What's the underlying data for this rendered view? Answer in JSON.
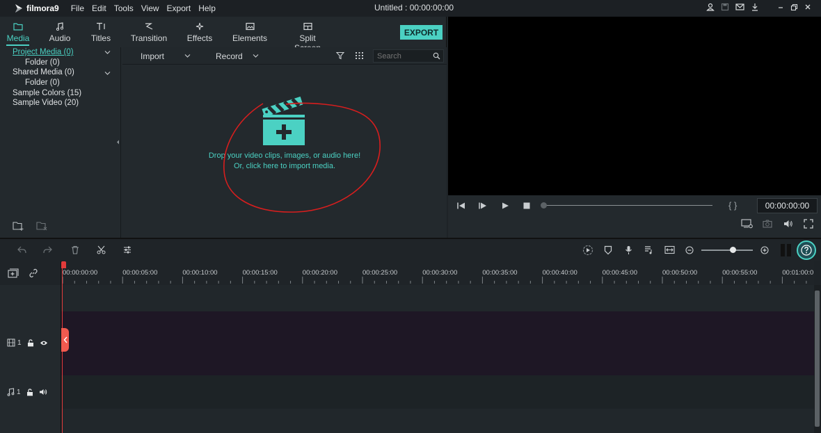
{
  "app": {
    "logo_text": "filmora9",
    "window_title": "Untitled : 00:00:00:00",
    "menu": [
      "File",
      "Edit",
      "Tools",
      "View",
      "Export",
      "Help"
    ]
  },
  "tabs": [
    {
      "label": "Media",
      "icon": "folder-icon",
      "active": true
    },
    {
      "label": "Audio",
      "icon": "music-note-icon"
    },
    {
      "label": "Titles",
      "icon": "text-icon"
    },
    {
      "label": "Transition",
      "icon": "transition-icon"
    },
    {
      "label": "Effects",
      "icon": "sparkle-icon"
    },
    {
      "label": "Elements",
      "icon": "image-icon"
    },
    {
      "label": "Split Screen",
      "icon": "split-screen-icon"
    }
  ],
  "export_label": "EXPORT",
  "folders": [
    {
      "label": "Project Media (0)",
      "selected": true
    },
    {
      "label": "Folder (0)"
    },
    {
      "label": "Shared Media (0)"
    },
    {
      "label": "Folder (0)"
    },
    {
      "label": "Sample Colors (15)"
    },
    {
      "label": "Sample Video (20)"
    }
  ],
  "library_toolbar": {
    "import_label": "Import",
    "record_label": "Record",
    "search_placeholder": "Search"
  },
  "drop_zone": {
    "line1": "Drop your video clips, images, or audio here!",
    "line2": "Or, click here to import media."
  },
  "preview": {
    "timecode": "00:00:00:00",
    "bracket_label": "{ }"
  },
  "timeline": {
    "ruler_labels": [
      "00:00:00:00",
      "00:00:05:00",
      "00:00:10:00",
      "00:00:15:00",
      "00:00:20:00",
      "00:00:25:00",
      "00:00:30:00",
      "00:00:35:00",
      "00:00:40:00",
      "00:00:45:00",
      "00:00:50:00",
      "00:00:55:00",
      "00:01:00:0"
    ],
    "video_track_number": "1",
    "audio_track_number": "1"
  },
  "colors": {
    "accent": "#4bd1c3",
    "annotation": "#d81e1e",
    "playhead": "#e23b3b"
  }
}
